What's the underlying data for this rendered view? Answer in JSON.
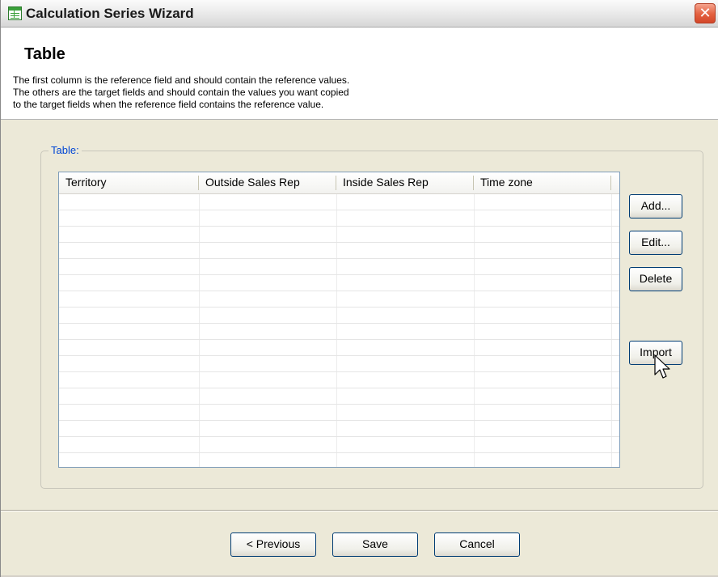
{
  "window": {
    "title": "Calculation Series Wizard",
    "close_glyph": "✕"
  },
  "header": {
    "title": "Table",
    "description": "The first column is the reference field and should contain the reference values.\nThe others are the target fields and should contain  the values you want copied\nto the target fields when the reference field contains the reference value."
  },
  "group": {
    "legend": "Table:"
  },
  "table": {
    "columns": [
      "Territory",
      "Outside Sales Rep",
      "Inside Sales Rep",
      "Time zone"
    ],
    "rows": []
  },
  "side_buttons": {
    "add": "Add...",
    "edit": "Edit...",
    "delete": "Delete",
    "import": "Import"
  },
  "footer": {
    "previous": "< Previous",
    "save": "Save",
    "cancel": "Cancel"
  },
  "colors": {
    "legend": "#0046d5",
    "button_border": "#003c74",
    "close": "#e3603f"
  }
}
